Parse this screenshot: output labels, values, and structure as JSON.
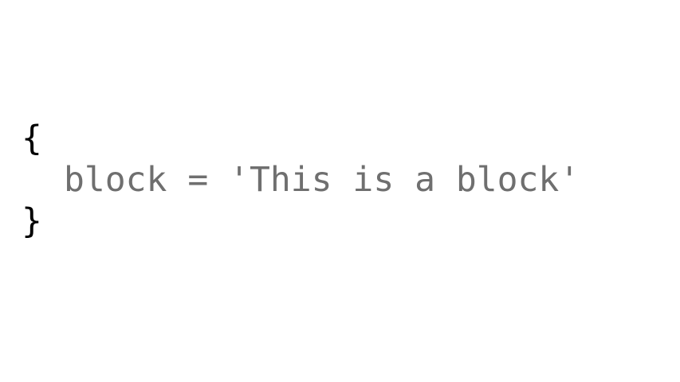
{
  "code": {
    "open_brace": "{",
    "body_line": "block = 'This is a block'",
    "close_brace": "}"
  },
  "colors": {
    "background": "#ffffff",
    "brace": "#000000",
    "code_text": "#6f6f6f"
  }
}
